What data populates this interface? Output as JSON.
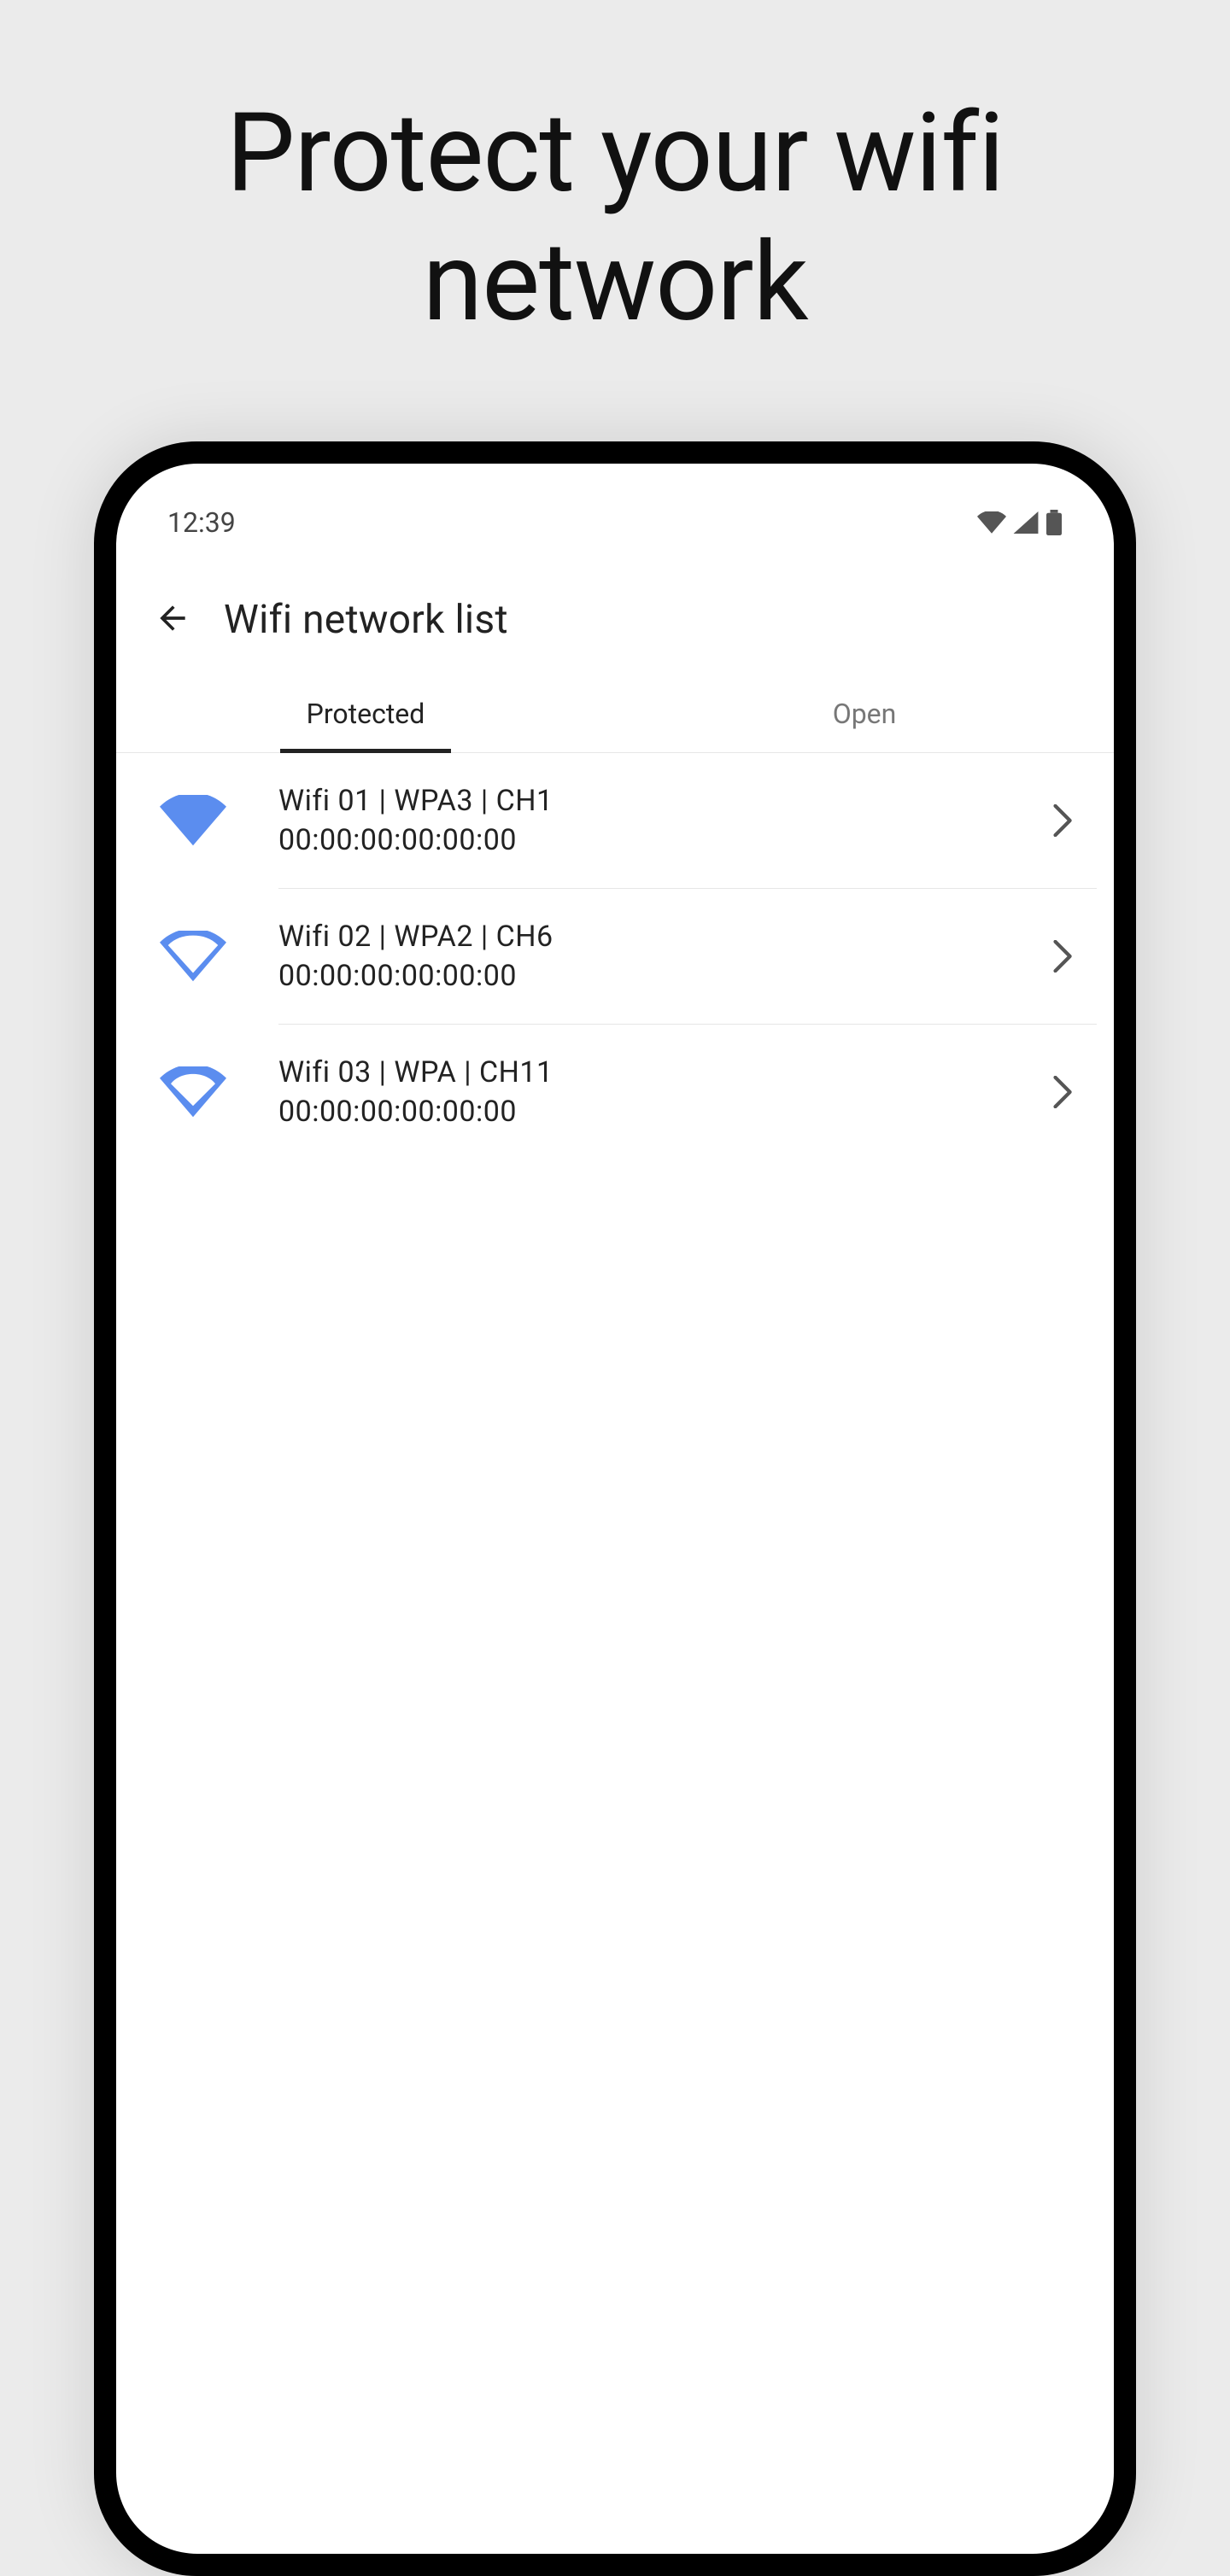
{
  "hero": {
    "title_line1": "Protect your wifi",
    "title_line2": "network"
  },
  "statusbar": {
    "time": "12:39"
  },
  "appbar": {
    "title": "Wifi network list"
  },
  "tabs": {
    "protected": "Protected",
    "open": "Open",
    "active": "protected"
  },
  "wifi": {
    "items": [
      {
        "title": "Wifi 01 | WPA3 | CH1",
        "mac": "00:00:00:00:00:00",
        "signal": "full"
      },
      {
        "title": "Wifi 02 | WPA2 | CH6",
        "mac": "00:00:00:00:00:00",
        "signal": "medium"
      },
      {
        "title": "Wifi 03 | WPA | CH11",
        "mac": "00:00:00:00:00:00",
        "signal": "low"
      }
    ]
  },
  "colors": {
    "accent": "#5b8def"
  }
}
